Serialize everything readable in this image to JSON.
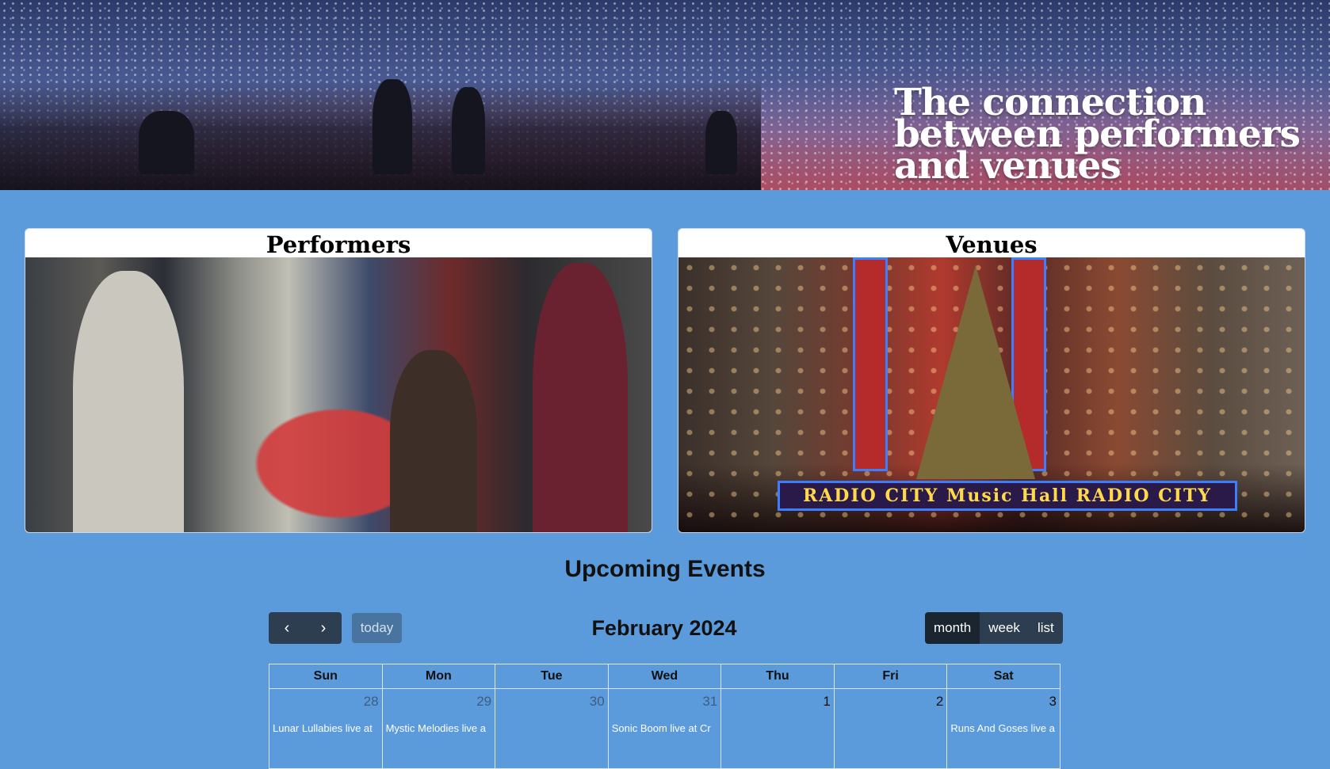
{
  "hero": {
    "title": "The connection between performers and venues"
  },
  "cards": {
    "performers": {
      "title": "Performers"
    },
    "venues": {
      "title": "Venues",
      "marquee_text": "RADIO CITY Music Hall RADIO CITY"
    }
  },
  "events": {
    "heading": "Upcoming Events",
    "calendar": {
      "title": "February 2024",
      "prev_icon": "chevron-left-icon",
      "next_icon": "chevron-right-icon",
      "prev_glyph": "‹",
      "next_glyph": "›",
      "today_label": "today",
      "views": [
        {
          "label": "month",
          "active": true
        },
        {
          "label": "week",
          "active": false
        },
        {
          "label": "list",
          "active": false
        }
      ],
      "weekdays": [
        "Sun",
        "Mon",
        "Tue",
        "Wed",
        "Thu",
        "Fri",
        "Sat"
      ],
      "weeks": [
        [
          {
            "day": "28",
            "other_month": true,
            "event": "Lunar Lullabies live at"
          },
          {
            "day": "29",
            "other_month": true,
            "event": "Mystic Melodies live a"
          },
          {
            "day": "30",
            "other_month": true,
            "event": ""
          },
          {
            "day": "31",
            "other_month": true,
            "event": "Sonic Boom live at Cr"
          },
          {
            "day": "1",
            "other_month": false,
            "event": ""
          },
          {
            "day": "2",
            "other_month": false,
            "event": ""
          },
          {
            "day": "3",
            "other_month": false,
            "event": "Runs And Goses live a"
          }
        ]
      ]
    }
  },
  "colors": {
    "page_background": "#5b9bdc",
    "button_dark": "#2c3e50",
    "button_active": "#1a252f",
    "today_button": "#4a74a0"
  }
}
